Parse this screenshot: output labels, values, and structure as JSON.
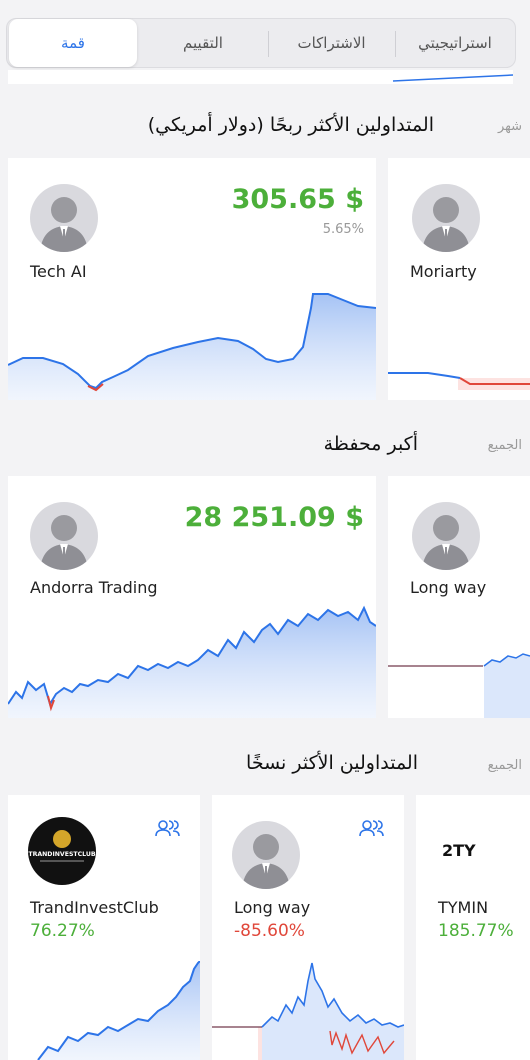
{
  "tabs": [
    {
      "label": "استراتيجيتي"
    },
    {
      "label": "الاشتراكات"
    },
    {
      "label": "التقييم"
    },
    {
      "label": "قمة"
    }
  ],
  "section_profit": {
    "title": "المتداولين الأكثر ربحًا (دولار أمريكي)",
    "link": "شهر",
    "cards": [
      {
        "name": "Tech AI",
        "amount": "305.65 $",
        "percent": "5.65%"
      },
      {
        "name": "Moriarty"
      }
    ]
  },
  "section_portfolio": {
    "title": "أكبر محفظة",
    "link": "الجميع",
    "cards": [
      {
        "name": "Andorra Trading",
        "amount": "28 251.09 $"
      },
      {
        "name": "Long way"
      }
    ]
  },
  "section_copied": {
    "title": "المتداولين الأكثر نسخًا",
    "link": "الجميع",
    "cards": [
      {
        "name": "TrandInvestClub",
        "value": "76.27%",
        "logo_text": "TRANDINVESTCLUB"
      },
      {
        "name": "Long way",
        "value": "-85.60%"
      },
      {
        "name": "TYMIN",
        "value": "185.77%",
        "logo_text": "2TY"
      }
    ]
  },
  "colors": {
    "accent": "#2d74e8",
    "positive": "#4caf3a",
    "negative": "#e0473a"
  }
}
